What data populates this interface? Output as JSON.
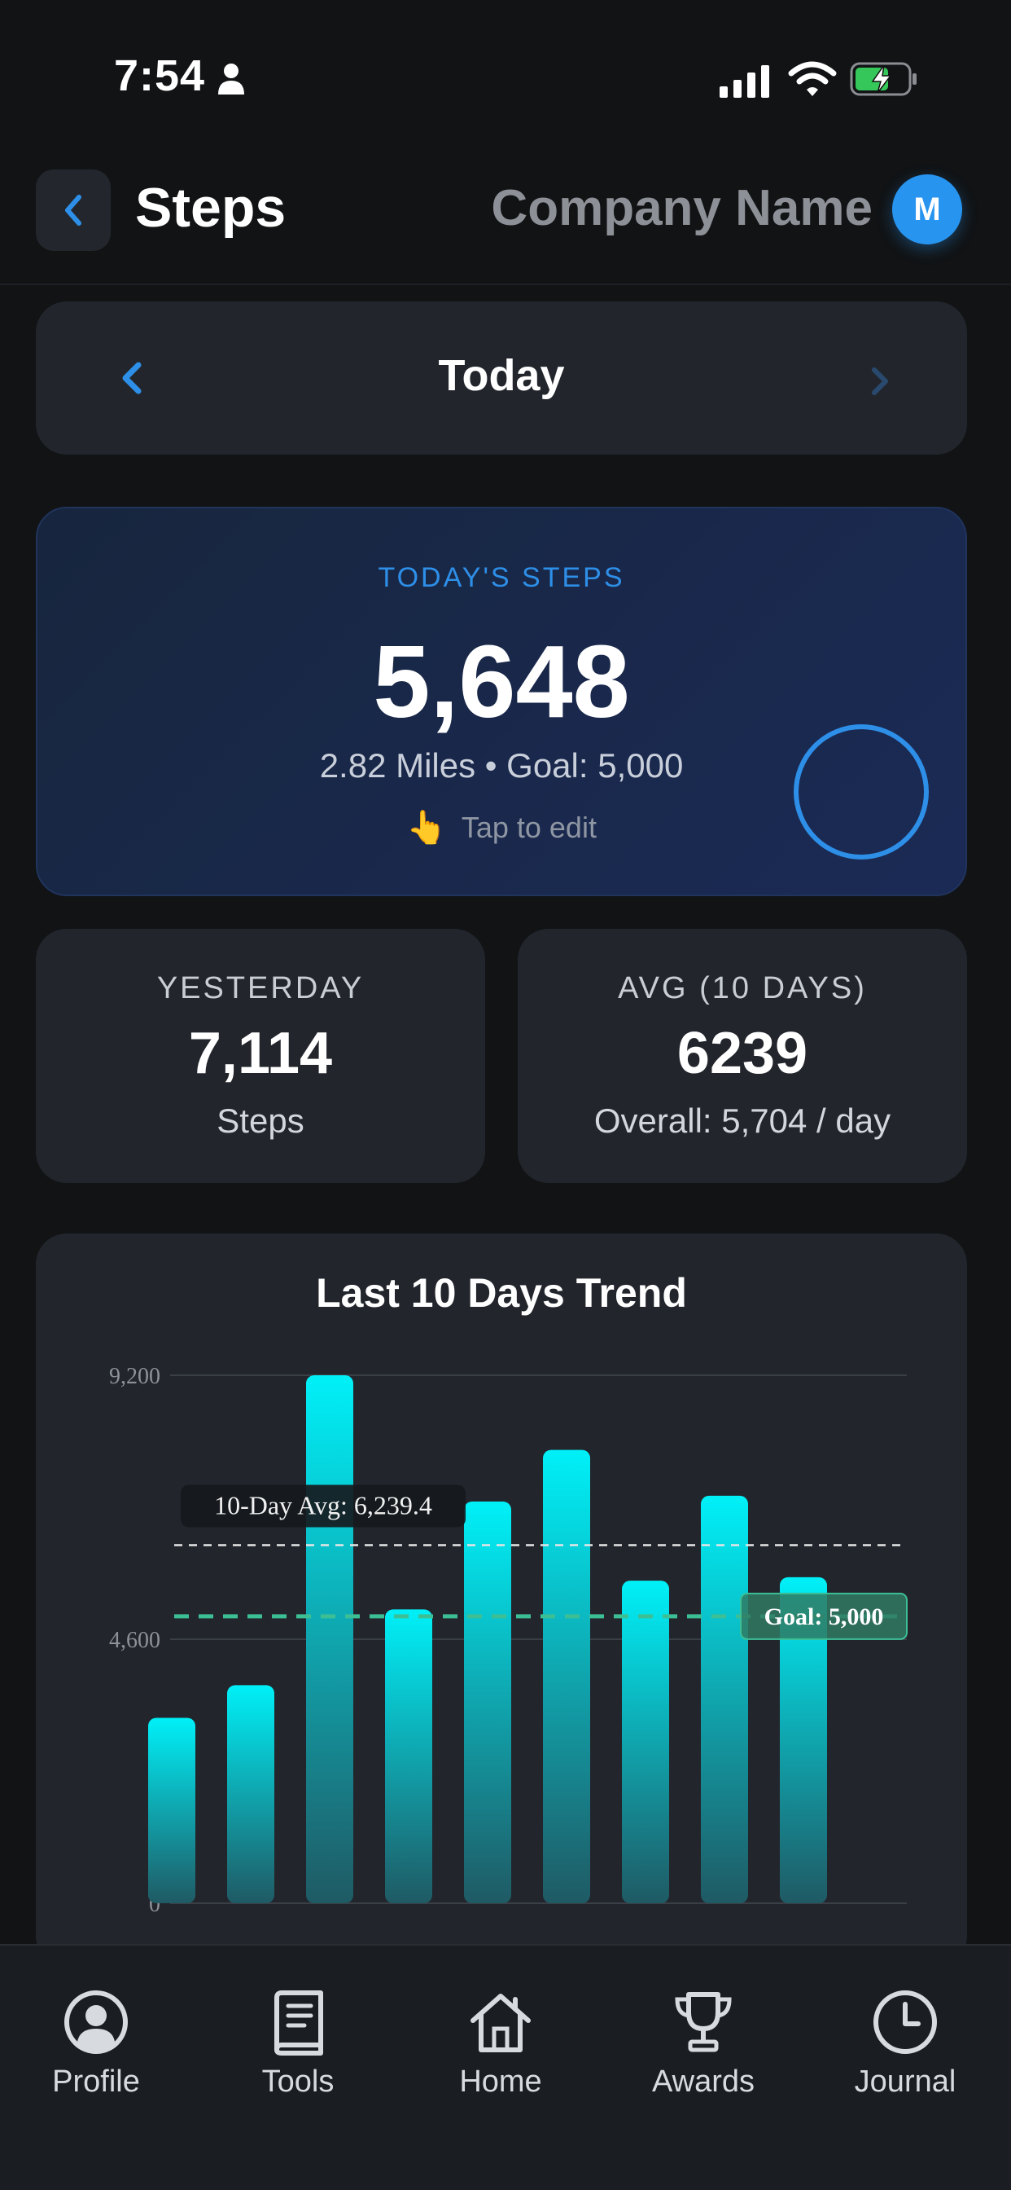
{
  "status_bar": {
    "time": "7:54",
    "icons": [
      "person-icon",
      "signal-icon",
      "wifi-icon",
      "battery-charging-icon"
    ]
  },
  "header": {
    "back_icon": "chevron-left-icon",
    "title": "Steps",
    "company": "Company Name",
    "avatar_initial": "M"
  },
  "date_nav": {
    "label": "Today",
    "prev_icon": "chevron-left-icon",
    "next_icon": "chevron-right-icon"
  },
  "today": {
    "eyebrow": "TODAY'S STEPS",
    "value": "5,648",
    "subtitle": "2.82 Miles • Goal: 5,000",
    "tap_icon": "👆",
    "tap_text": "Tap to edit",
    "accent": "#2e8fe8"
  },
  "stats": {
    "yesterday": {
      "label": "YESTERDAY",
      "value": "7,114",
      "sub": "Steps"
    },
    "average": {
      "label": "AVG (10 DAYS)",
      "value": "6239",
      "sub": "Overall: 5,704 / day"
    }
  },
  "chart_data": {
    "type": "bar",
    "title": "Last 10 Days Trend",
    "xlabel": "",
    "ylabel": "",
    "y_ticks": [
      0,
      4600,
      9200
    ],
    "y_tick_labels": [
      "0",
      "4,600",
      "9,200"
    ],
    "ylim": [
      0,
      9200
    ],
    "values": [
      3230,
      3800,
      9200,
      5120,
      7000,
      7900,
      5620,
      7100,
      5680
    ],
    "avg_line": {
      "value": 6239.4,
      "label": "10-Day Avg: 6,239.4"
    },
    "goal_line": {
      "value": 5000,
      "label": "Goal: 5,000"
    },
    "bar_color_top": "#00f0f8",
    "bar_color_bottom": "#1f5a64",
    "goal_color": "#3dbf96",
    "grid": true
  },
  "tab_bar": {
    "tabs": [
      {
        "label": "Profile",
        "icon": "user-circle-icon"
      },
      {
        "label": "Tools",
        "icon": "book-icon"
      },
      {
        "label": "Home",
        "icon": "home-icon"
      },
      {
        "label": "Awards",
        "icon": "trophy-icon"
      },
      {
        "label": "Journal",
        "icon": "clock-icon"
      }
    ]
  }
}
